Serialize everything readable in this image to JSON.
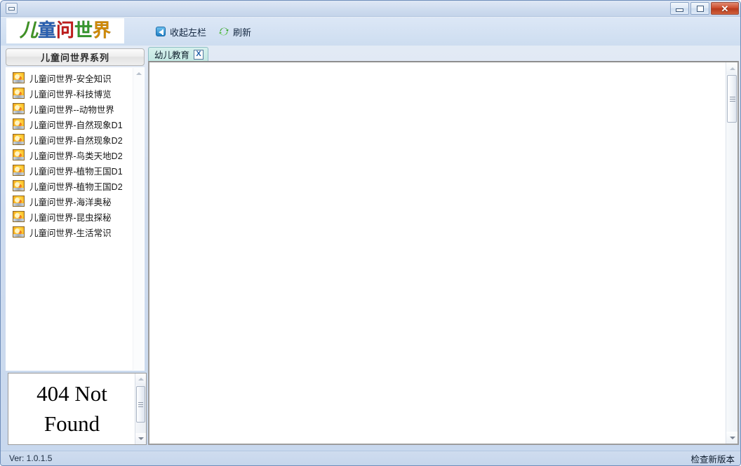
{
  "window": {
    "title": "",
    "sys_menu_icon": "window-restore-icon",
    "buttons": {
      "minimize": "minimize-icon",
      "restore": "restore-icon",
      "close": "✕"
    }
  },
  "header": {
    "logo_chars": [
      "儿",
      "童",
      "问",
      "世",
      "界"
    ],
    "logo_colors": [
      "#49ab2a",
      "#2f6fd0",
      "#e02020",
      "#3fae36",
      "#f2a007"
    ],
    "toolbar": [
      {
        "label": "收起左栏",
        "icon": "collapse-left-panel-icon"
      },
      {
        "label": "刷新",
        "icon": "refresh-icon"
      }
    ]
  },
  "sidebar": {
    "header_title": "儿童问世界系列",
    "items": [
      {
        "label": "儿童问世界-安全知识",
        "icon": "series-thumbnail-icon"
      },
      {
        "label": "儿童问世界-科技博览",
        "icon": "series-thumbnail-icon"
      },
      {
        "label": "儿童问世界--动物世界",
        "icon": "series-thumbnail-icon"
      },
      {
        "label": "儿童问世界-自然现象D1",
        "icon": "series-thumbnail-icon"
      },
      {
        "label": "儿童问世界-自然现象D2",
        "icon": "series-thumbnail-icon"
      },
      {
        "label": "儿童问世界-鸟类天地D2",
        "icon": "series-thumbnail-icon"
      },
      {
        "label": "儿童问世界-植物王国D1",
        "icon": "series-thumbnail-icon"
      },
      {
        "label": "儿童问世界-植物王国D2",
        "icon": "series-thumbnail-icon"
      },
      {
        "label": "儿童问世界-海洋奥秘",
        "icon": "series-thumbnail-icon"
      },
      {
        "label": "儿童问世界-昆虫探秘",
        "icon": "series-thumbnail-icon"
      },
      {
        "label": "儿童问世界-生活常识",
        "icon": "series-thumbnail-icon"
      }
    ],
    "bottom_panel": {
      "line1": "404  Not",
      "line2": "Found"
    }
  },
  "main": {
    "tabs": [
      {
        "label": "幼儿教育",
        "close_glyph": "X"
      }
    ],
    "content": ""
  },
  "status": {
    "version": "Ver: 1.0.1.5",
    "update_link": "检查新版本"
  }
}
